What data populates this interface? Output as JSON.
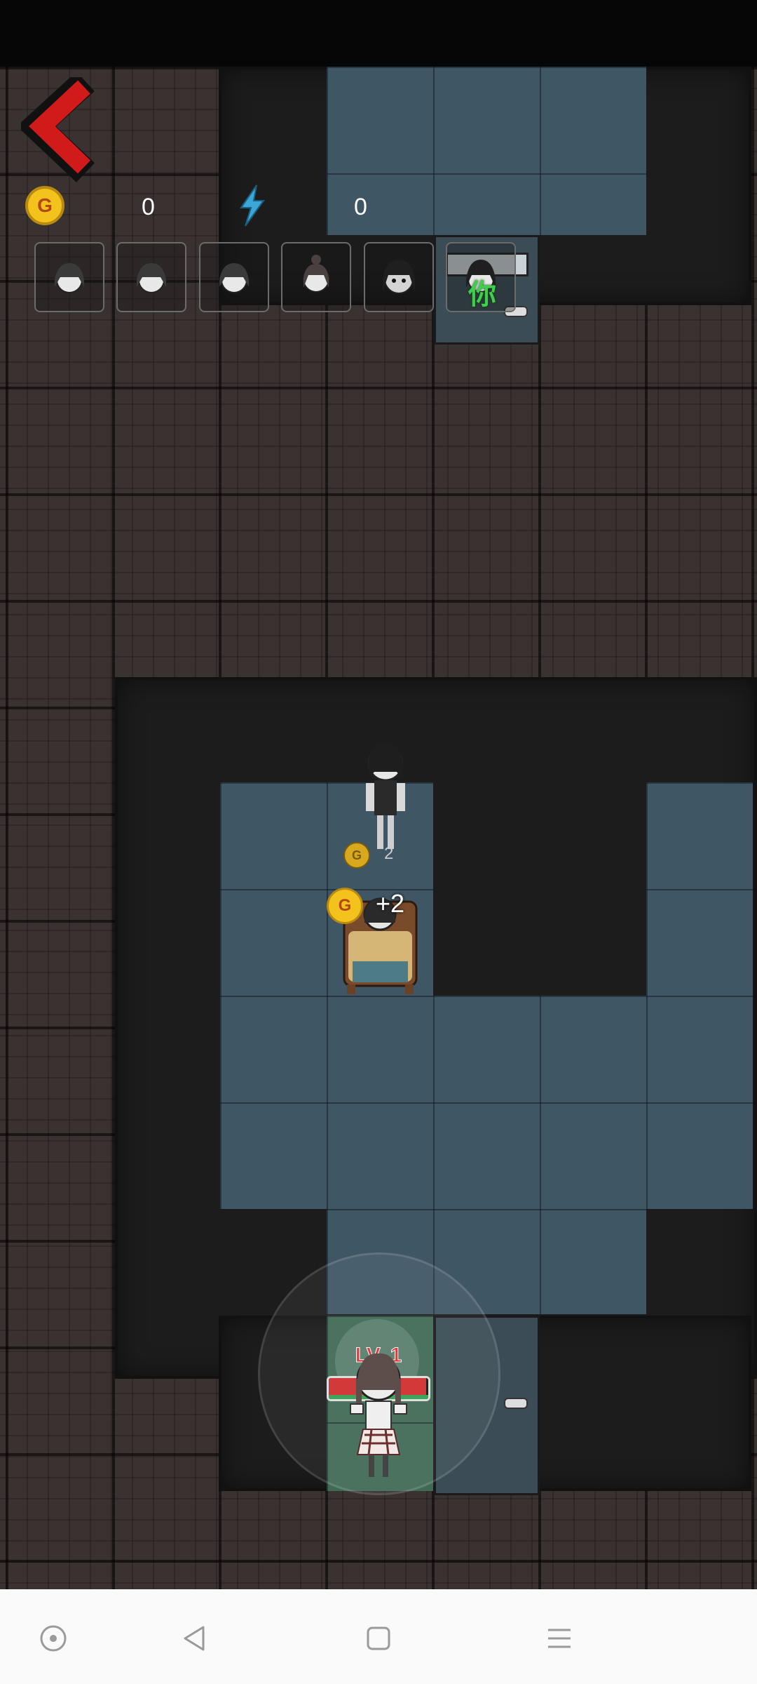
{
  "hud": {
    "coins": "0",
    "energy": "0",
    "coin_icon_letter": "G",
    "portraits": [
      "girl-portrait-1",
      "girl-portrait-2",
      "girl-portrait-3",
      "bun-girl-portrait",
      "pale-ghost-portrait",
      "ghost-girl-portrait-locked"
    ],
    "locked_portrait_mark": "你"
  },
  "world": {
    "coin_popup": "+2",
    "coin_popup_small": "2",
    "player_level": "LV. 1",
    "player_hp_fraction": 0.98
  },
  "colors": {
    "back_arrow": "#d11a1a",
    "coin": "#f3c21d",
    "energy": "#3ba7d6",
    "hp": "#d23a3a"
  }
}
